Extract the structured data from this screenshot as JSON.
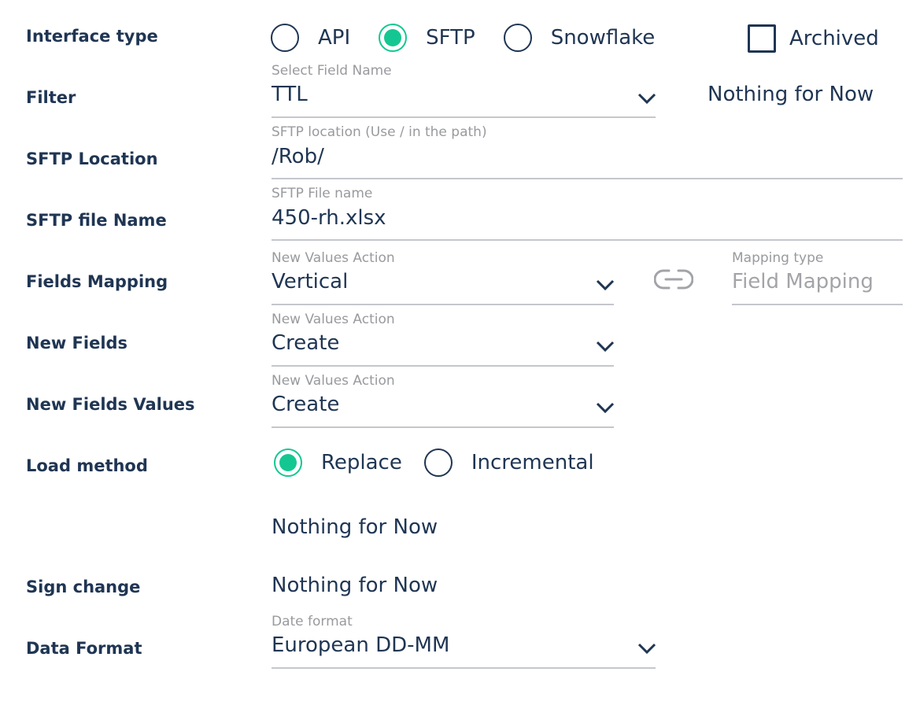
{
  "rows": {
    "interface_type": "Interface type",
    "filter": "Filter",
    "sftp_location": "SFTP Location",
    "sftp_file_name": "SFTP file Name",
    "fields_mapping": "Fields Mapping",
    "new_fields": "New Fields",
    "new_fields_values": "New Fields Values",
    "load_method": "Load method",
    "sign_change": "Sign change",
    "data_format": "Data Format"
  },
  "interface_type": {
    "options": [
      "API",
      "SFTP",
      "Snowflake"
    ],
    "selected": "SFTP",
    "archived_label": "Archived",
    "archived_checked": false
  },
  "filter": {
    "label": "Select Field Name",
    "value": "TTL",
    "side_text": "Nothing for Now"
  },
  "sftp_location": {
    "label": "SFTP location (Use / in the path)",
    "value": "/Rob/"
  },
  "sftp_file_name": {
    "label": "SFTP File name",
    "value": "450-rh.xlsx"
  },
  "fields_mapping": {
    "label": "New Values Action",
    "value": "Vertical",
    "link_icon": "link-icon",
    "mapping_type_label": "Mapping type",
    "mapping_type_value": "Field Mapping"
  },
  "new_fields": {
    "label": "New Values Action",
    "value": "Create"
  },
  "new_fields_values": {
    "label": "New Values Action",
    "value": "Create"
  },
  "load_method": {
    "options": [
      "Replace",
      "Incremental"
    ],
    "selected": "Replace"
  },
  "extra_text": "Nothing for Now",
  "sign_change": {
    "value": "Nothing for Now"
  },
  "data_format": {
    "label": "Date format",
    "value": "European DD-MM"
  },
  "colors": {
    "text": "#1f3553",
    "accent": "#14c792",
    "label_gray": "#999a9e",
    "underline": "#c4c7cc"
  }
}
